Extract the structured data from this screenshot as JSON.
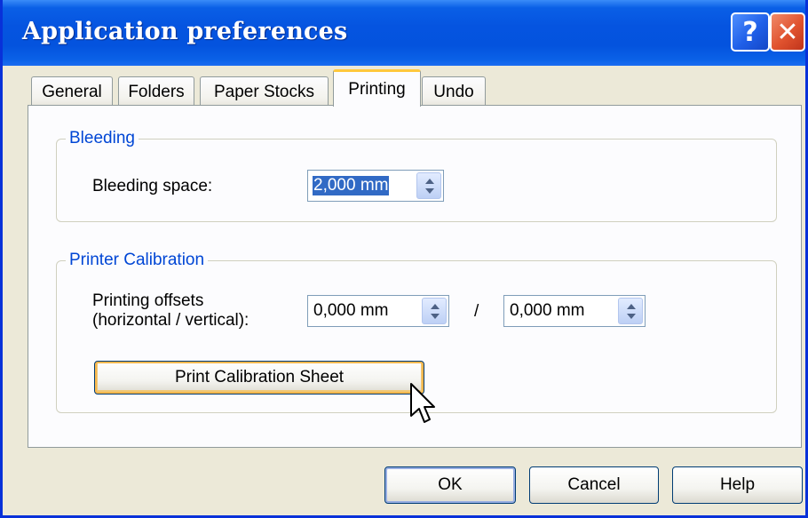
{
  "window": {
    "title": "Application preferences",
    "help_glyph": "?",
    "close_glyph": "✕"
  },
  "tabs": [
    {
      "label": "General"
    },
    {
      "label": "Folders"
    },
    {
      "label": "Paper Stocks"
    },
    {
      "label": "Printing",
      "active": true
    },
    {
      "label": "Undo"
    }
  ],
  "bleeding": {
    "group_title": "Bleeding",
    "label": "Bleeding space:",
    "value": "2,000 mm"
  },
  "calibration": {
    "group_title": "Printer Calibration",
    "label_line1": "Printing offsets",
    "label_line2": "(horizontal / vertical):",
    "horizontal_value": "0,000 mm",
    "separator": "/",
    "vertical_value": "0,000 mm",
    "print_button": "Print Calibration Sheet"
  },
  "footer": {
    "ok": "OK",
    "cancel": "Cancel",
    "help": "Help"
  },
  "colors": {
    "title_bar": "#0554e0",
    "group_title": "#0046d5",
    "selection": "#316ac5",
    "active_tab_accent": "#ffc83c"
  },
  "icons": [
    "help-icon",
    "close-icon",
    "spin-up-icon",
    "spin-down-icon",
    "mouse-pointer-icon"
  ]
}
